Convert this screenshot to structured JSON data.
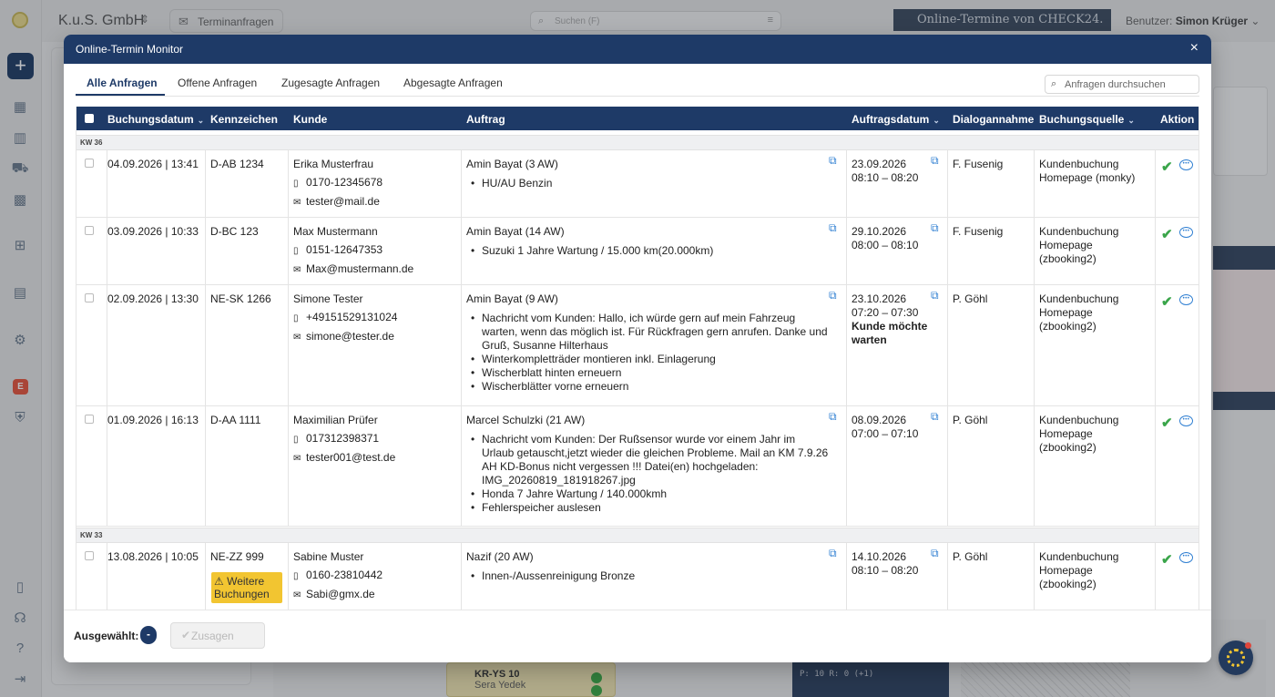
{
  "app": {
    "company": "K.u.S. GmbH",
    "termin_button": "Terminanfragen",
    "search_placeholder": "Suchen (F)",
    "banner": "Online-Termine von CHECK24.",
    "user_prefix": "Benutzer:",
    "user_name": "Simon Krüger",
    "sidebar_badge": "E",
    "bg_card_plate": "KR-YS 10",
    "bg_card_name": "Sera Yedek",
    "bg_dark_text": "P: 10  R: 0 (+1)"
  },
  "modal": {
    "title": "Online-Termin Monitor",
    "close": "×",
    "tabs": [
      "Alle Anfragen",
      "Offene Anfragen",
      "Zugesagte Anfragen",
      "Abgesagte Anfragen"
    ],
    "search_placeholder": "Anfragen durchsuchen",
    "footer": {
      "selected_label": "Ausgewählt:",
      "selected_count": "-",
      "confirm_button": "Zusagen"
    }
  },
  "table": {
    "headers": [
      "Buchungsdatum",
      "Kennzeichen",
      "Kunde",
      "Auftrag",
      "Auftragsdatum",
      "Dialogannahme",
      "Buchungsquelle",
      "Aktion"
    ],
    "groups": [
      {
        "week": "KW 36",
        "rows": [
          {
            "booking_date": "04.09.2026 | 13:41",
            "plate": "D-AB 1234",
            "customer": "Erika Musterfrau",
            "phone": "0170-12345678",
            "email": "tester@mail.de",
            "order_title": "Amin Bayat (3 AW)",
            "order_items": [
              "HU/AU Benzin"
            ],
            "appt_date": "23.09.2026",
            "appt_time": "08:10 – 08:20",
            "appt_note": "",
            "dialog": "F. Fusenig",
            "source": [
              "Kundenbuchung",
              "Homepage (monky)"
            ]
          },
          {
            "booking_date": "03.09.2026 | 10:33",
            "plate": "D-BC 123",
            "customer": "Max Mustermann",
            "phone": "0151-12647353",
            "email": "Max@mustermann.de",
            "order_title": "Amin Bayat (14 AW)",
            "order_items": [
              "Suzuki 1 Jahre Wartung / 15.000 km(20.000km)"
            ],
            "appt_date": "29.10.2026",
            "appt_time": "08:00 – 08:10",
            "appt_note": "",
            "dialog": "F. Fusenig",
            "source": [
              "Kundenbuchung",
              "Homepage",
              "(zbooking2)"
            ]
          },
          {
            "booking_date": "02.09.2026 | 13:30",
            "plate": "NE-SK 1266",
            "customer": "Simone Tester",
            "phone": "+49151529131024",
            "email": "simone@tester.de",
            "order_title": "Amin Bayat (9 AW)",
            "order_items": [
              "Nachricht vom Kunden: Hallo, ich würde gern auf mein Fahrzeug warten, wenn das möglich ist. Für Rückfragen gern anrufen. Danke und Gruß, Susanne Hilterhaus",
              "Winterkompletträder montieren inkl. Einlagerung",
              "Wischerblatt hinten erneuern",
              "Wischerblätter vorne erneuern"
            ],
            "appt_date": "23.10.2026",
            "appt_time": "07:20 – 07:30",
            "appt_note": "Kunde möchte warten",
            "dialog": "P. Göhl",
            "source": [
              "Kundenbuchung",
              "Homepage",
              "(zbooking2)"
            ]
          },
          {
            "booking_date": "01.09.2026 | 16:13",
            "plate": "D-AA 1111",
            "customer": "Maximilian Prüfer",
            "phone": "017312398371",
            "email": "tester001@test.de",
            "order_title": "Marcel Schulzki (21 AW)",
            "order_items": [
              "Nachricht vom Kunden: Der Rußsensor wurde vor einem Jahr im Urlaub getauscht,jetzt wieder die gleichen Probleme. Mail an KM 7.9.26 AH KD-Bonus nicht vergessen !!! Datei(en) hochgeladen: IMG_20260819_181918267.jpg",
              "Honda 7 Jahre Wartung / 140.000kmh",
              "Fehlerspeicher auslesen"
            ],
            "appt_date": "08.09.2026",
            "appt_time": "07:00 – 07:10",
            "appt_note": "",
            "dialog": "P. Göhl",
            "source": [
              "Kundenbuchung",
              "Homepage",
              "(zbooking2)"
            ]
          }
        ]
      },
      {
        "week": "KW 33",
        "rows": [
          {
            "booking_date": "13.08.2026 | 10:05",
            "plate": "NE-ZZ 999",
            "plate_badge": "Weitere Buchungen",
            "customer": "Sabine Muster",
            "phone": "0160-23810442",
            "email": "Sabi@gmx.de",
            "order_title": "Nazif (20 AW)",
            "order_items": [
              "Innen-/Aussenreinigung Bronze"
            ],
            "appt_date": "14.10.2026",
            "appt_time": "08:10 – 08:20",
            "appt_note": "",
            "dialog": "P. Göhl",
            "source": [
              "Kundenbuchung",
              "Homepage",
              "(zbooking2)"
            ]
          }
        ]
      }
    ]
  },
  "icons": {
    "phone": "phone-icon",
    "email": "envelope-icon",
    "external": "external-link-icon",
    "accept": "checkmark-icon",
    "comment": "speech-bubble-icon",
    "warning": "warning-triangle-icon"
  },
  "colors": {
    "primary": "#1e3a67",
    "accept_green": "#3aa54a",
    "link_blue": "#2f7fd2",
    "warning_yellow": "#f2c531"
  }
}
